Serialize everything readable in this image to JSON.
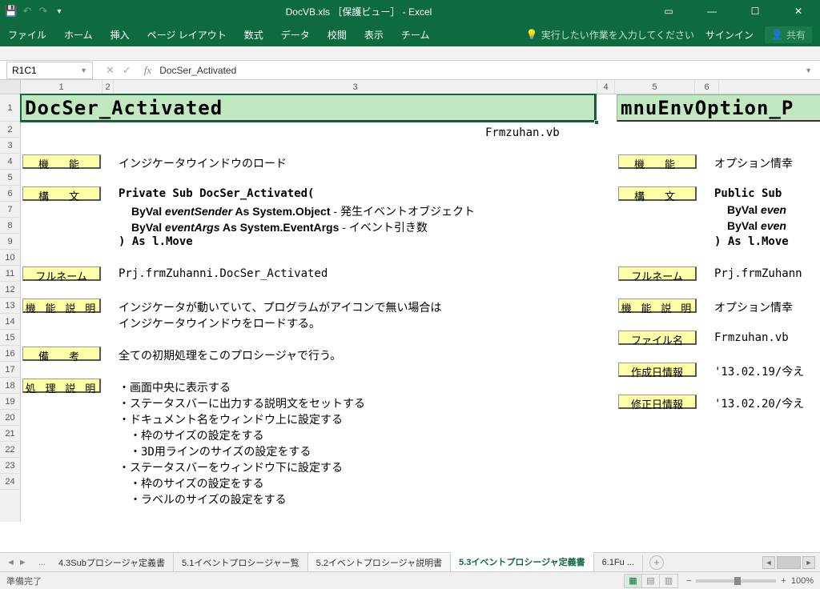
{
  "title": "DocVB.xls ［保護ビュー］ - Excel",
  "qat": {
    "save": "save",
    "undo": "undo",
    "redo": "redo"
  },
  "ribbon": {
    "tabs": [
      "ファイル",
      "ホーム",
      "挿入",
      "ページ レイアウト",
      "数式",
      "データ",
      "校閲",
      "表示",
      "チーム"
    ],
    "tell_me": "実行したい作業を入力してください",
    "signin": "サインイン",
    "share": "共有"
  },
  "fx": {
    "name_box": "R1C1",
    "formula": "DocSer_Activated"
  },
  "cols": [
    "1",
    "2",
    "3",
    "4",
    "5",
    "6"
  ],
  "rows_big": "1",
  "rows": [
    "2",
    "3",
    "4",
    "5",
    "6",
    "7",
    "8",
    "9",
    "10",
    "11",
    "12",
    "13",
    "14",
    "15",
    "16",
    "17",
    "18",
    "19",
    "20",
    "21",
    "22",
    "23",
    "24"
  ],
  "cells": {
    "title1": "DocSer_Activated",
    "title2": "mnuEnvOption_P",
    "file": "Frmzuhan.vb",
    "l_func": "機　能",
    "v_func": "インジケータウインドウのロード",
    "l_syn": "構　文",
    "syn1": "Private Sub DocSer_Activated(",
    "syn2a": "ByVal ",
    "syn2b": "eventSender",
    "syn2c": "  As System.Object",
    "syn2d": "   - 発生イベントオブジェクト",
    "syn3a": "ByVal ",
    "syn3b": "eventArgs",
    "syn3c": "   As System.EventArgs",
    "syn3d": " - イベント引き数",
    "syn4": ") As l.Move",
    "l_full": "フルネーム",
    "v_full": "Prj.frmZuhanni.DocSer_Activated",
    "l_desc": "機 能 説 明",
    "v_desc1": "インジケータが動いていて、プログラムがアイコンで無い場合は",
    "v_desc2": "インジケータウインドウをロードする。",
    "l_note": "備　考",
    "v_note": "全ての初期処理をこのプロシージャで行う。",
    "l_proc": "処 理 説 明",
    "p1": "・画面中央に表示する",
    "p2": "・ステータスバーに出力する説明文をセットする",
    "p3": "・ドキュメント名をウィンドウ上に設定する",
    "p4": "　・枠のサイズの設定をする",
    "p5": "　・3D用ラインのサイズの設定をする",
    "p6": "・ステータスバーをウィンドウ下に設定する",
    "p7": "　・枠のサイズの設定をする",
    "p8": "　・ラベルのサイズの設定をする",
    "r_func": "機　能",
    "r_funcv": "オプション情幸",
    "r_syn": "構　文",
    "r_syn1": "Public Sub",
    "r_syn2a": "ByVal ",
    "r_syn2b": "even",
    "r_syn3a": "ByVal ",
    "r_syn3b": "even",
    "r_syn4": ") As l.Move",
    "r_full": "フルネーム",
    "r_fullv": "Prj.frmZuhann",
    "r_desc": "機 能 説 明",
    "r_descv": "オプション情幸",
    "r_file": "ファイル名",
    "r_filev": "Frmzuhan.vb",
    "r_cdate": "作成日情報",
    "r_cdatev": "'13.02.19/今え",
    "r_mdate": "修正日情報",
    "r_mdatev": "'13.02.20/今え"
  },
  "tabs": {
    "t1": "4.3Subプロシージャ定義書",
    "t2": "5.1イベントプロシージャー覧",
    "t3": "5.2イベントプロシージャ説明書",
    "active": "5.3イベントプロシージャ定義書",
    "t5": "6.1Fu ..."
  },
  "status": {
    "ready": "準備完了",
    "zoom": "100%"
  }
}
